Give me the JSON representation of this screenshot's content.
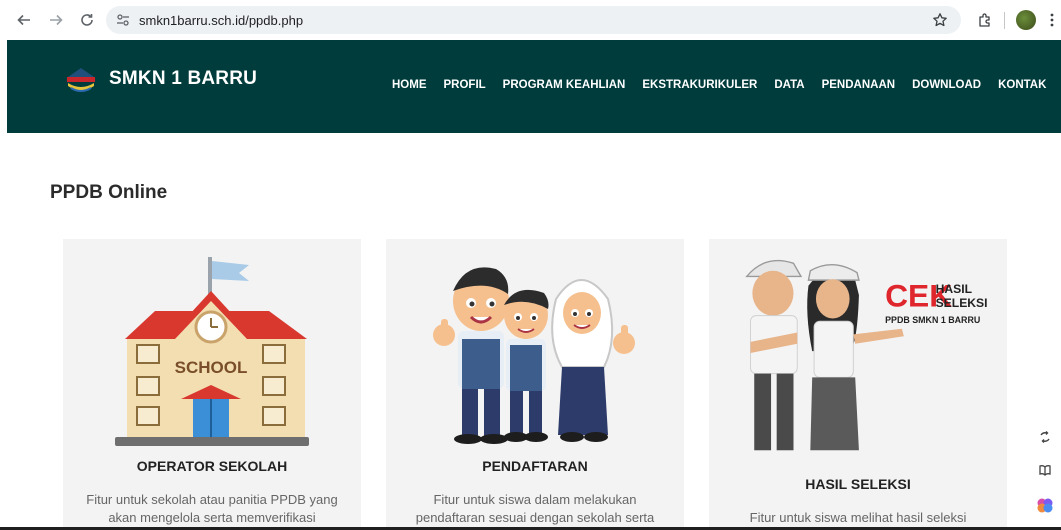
{
  "browser": {
    "url": "smkn1barru.sch.id/ppdb.php"
  },
  "site": {
    "brand": "SMKN 1 BARRU",
    "header_color": "#003c3c",
    "nav": [
      "HOME",
      "PROFIL",
      "PROGRAM KEAHLIAN",
      "EKSTRAKURIKULER",
      "DATA",
      "PENDANAAN",
      "DOWNLOAD",
      "KONTAK"
    ]
  },
  "page": {
    "title": "PPDB Online"
  },
  "cards": [
    {
      "title": "OPERATOR SEKOLAH",
      "desc": "Fitur untuk sekolah atau panitia PPDB yang akan mengelola serta memverifikasi",
      "image_label": "SCHOOL"
    },
    {
      "title": "PENDAFTARAN",
      "desc": "Fitur untuk siswa dalam melakukan pendaftaran sesuai dengan sekolah serta"
    },
    {
      "title": "HASIL SELEKSI",
      "desc": "Fitur untuk siswa melihat hasil seleksi",
      "image_text": {
        "cek": "CEK",
        "hasil": "HASIL",
        "seleksi": "SELEKSI",
        "sub": "PPDB SMKN 1 BARRU"
      }
    }
  ],
  "icons": {
    "back": "arrow-left-icon",
    "forward": "arrow-right-icon",
    "reload": "reload-icon",
    "site_info": "tune-icon",
    "star": "star-icon",
    "extensions": "puzzle-icon",
    "menu": "kebab-icon",
    "side": [
      "sync-icon",
      "book-icon",
      "brain-icon"
    ]
  }
}
